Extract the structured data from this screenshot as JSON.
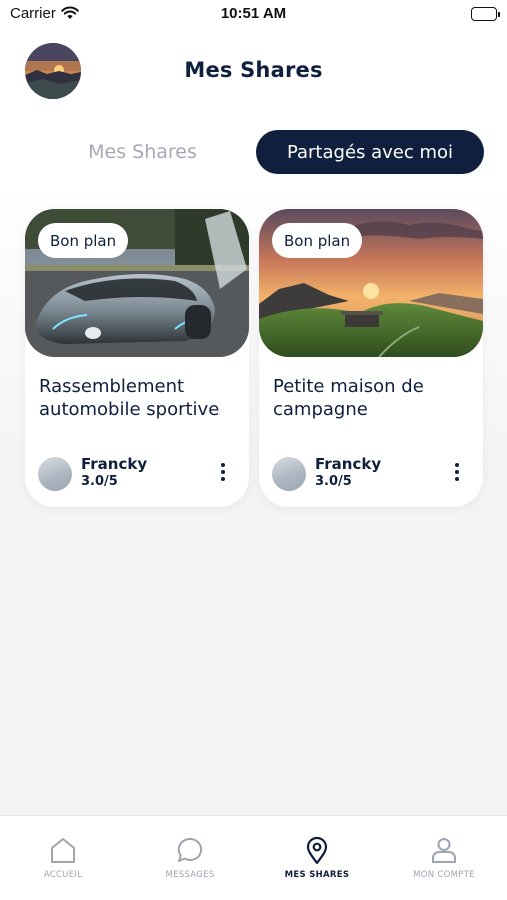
{
  "status_bar": {
    "carrier": "Carrier",
    "time": "10:51 AM"
  },
  "header": {
    "title": "Mes Shares"
  },
  "tabs": [
    {
      "label": "Mes Shares",
      "active": false
    },
    {
      "label": "Partagés avec moi",
      "active": true
    }
  ],
  "cards": [
    {
      "badge": "Bon plan",
      "title": "Rassemblement automobile sportive",
      "author": "Francky",
      "rating": "3.0/5"
    },
    {
      "badge": "Bon plan",
      "title": "Petite maison de campagne",
      "author": "Francky",
      "rating": "3.0/5"
    }
  ],
  "nav": [
    {
      "label": "ACCUEIL",
      "icon": "home-icon",
      "active": false
    },
    {
      "label": "MESSAGES",
      "icon": "chat-bubble-icon",
      "active": false
    },
    {
      "label": "MES SHARES",
      "icon": "map-pin-icon",
      "active": true
    },
    {
      "label": "MON COMPTE",
      "icon": "user-icon",
      "active": false
    }
  ],
  "colors": {
    "primary": "#0f1f3d",
    "inactive": "#9ea5b1",
    "background": "#f4f4f5"
  }
}
